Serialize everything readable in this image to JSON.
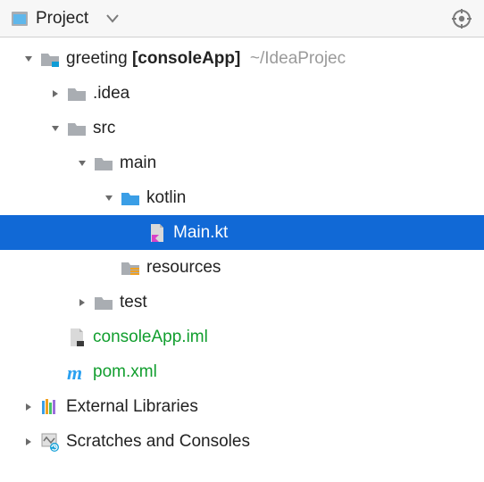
{
  "header": {
    "title": "Project"
  },
  "tree": {
    "root": {
      "name": "greeting",
      "module": "[consoleApp]",
      "path": "~/IdeaProjec"
    },
    "idea": ".idea",
    "src": "src",
    "main": "main",
    "kotlin": "kotlin",
    "mainkt": "Main.kt",
    "resources": "resources",
    "test": "test",
    "iml": "consoleApp.iml",
    "pom": "pom.xml",
    "ext": "External Libraries",
    "scratches": "Scratches and Consoles"
  }
}
